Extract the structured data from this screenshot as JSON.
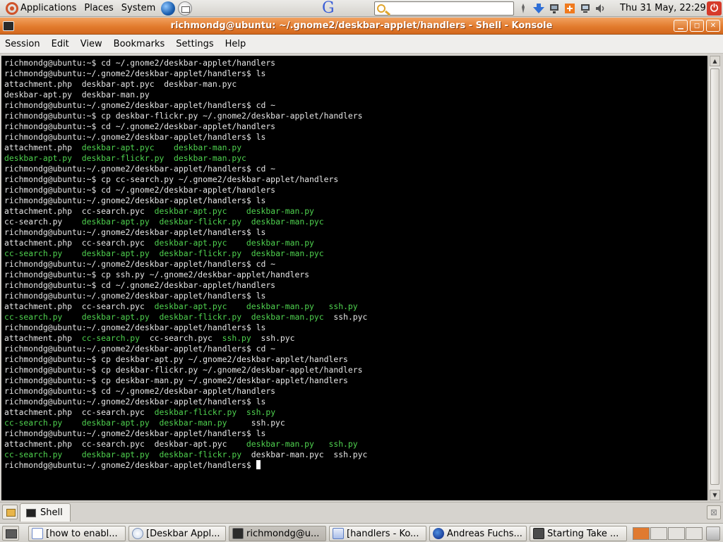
{
  "top_panel": {
    "menus": [
      "Applications",
      "Places",
      "System"
    ],
    "search_placeholder": "",
    "clock": "Thu 31 May, 22:29"
  },
  "window": {
    "title": "richmondg@ubuntu: ~/.gnome2/deskbar-applet/handlers - Shell - Konsole",
    "menu": [
      "Session",
      "Edit",
      "View",
      "Bookmarks",
      "Settings",
      "Help"
    ]
  },
  "terminal": {
    "lines": [
      [
        {
          "t": "richmondg@ubuntu:~$ cd ~/.gnome2/deskbar-applet/handlers"
        }
      ],
      [
        {
          "t": "richmondg@ubuntu:~/.gnome2/deskbar-applet/handlers$ ls"
        }
      ],
      [
        {
          "t": "attachment.php  deskbar-apt.pyc  deskbar-man.pyc"
        }
      ],
      [
        {
          "t": "deskbar-apt.py  deskbar-man.py"
        }
      ],
      [
        {
          "t": "richmondg@ubuntu:~/.gnome2/deskbar-applet/handlers$ cd ~"
        }
      ],
      [
        {
          "t": "richmondg@ubuntu:~$ cp deskbar-flickr.py ~/.gnome2/deskbar-applet/handlers"
        }
      ],
      [
        {
          "t": "richmondg@ubuntu:~$ cd ~/.gnome2/deskbar-applet/handlers"
        }
      ],
      [
        {
          "t": "richmondg@ubuntu:~/.gnome2/deskbar-applet/handlers$ ls"
        }
      ],
      [
        {
          "t": "attachment.php  "
        },
        {
          "t": "deskbar-apt.pyc",
          "g": true
        },
        {
          "t": "    "
        },
        {
          "t": "deskbar-man.py",
          "g": true
        }
      ],
      [
        {
          "t": "deskbar-apt.py",
          "g": true
        },
        {
          "t": "  "
        },
        {
          "t": "deskbar-flickr.py",
          "g": true
        },
        {
          "t": "  "
        },
        {
          "t": "deskbar-man.pyc",
          "g": true
        }
      ],
      [
        {
          "t": "richmondg@ubuntu:~/.gnome2/deskbar-applet/handlers$ cd ~"
        }
      ],
      [
        {
          "t": "richmondg@ubuntu:~$ cp cc-search.py ~/.gnome2/deskbar-applet/handlers"
        }
      ],
      [
        {
          "t": "richmondg@ubuntu:~$ cd ~/.gnome2/deskbar-applet/handlers"
        }
      ],
      [
        {
          "t": "richmondg@ubuntu:~/.gnome2/deskbar-applet/handlers$ ls"
        }
      ],
      [
        {
          "t": "attachment.php  cc-search.pyc  "
        },
        {
          "t": "deskbar-apt.pyc",
          "g": true
        },
        {
          "t": "    "
        },
        {
          "t": "deskbar-man.py",
          "g": true
        }
      ],
      [
        {
          "t": "cc-search.py    "
        },
        {
          "t": "deskbar-apt.py",
          "g": true
        },
        {
          "t": "  "
        },
        {
          "t": "deskbar-flickr.py",
          "g": true
        },
        {
          "t": "  "
        },
        {
          "t": "deskbar-man.pyc",
          "g": true
        }
      ],
      [
        {
          "t": "richmondg@ubuntu:~/.gnome2/deskbar-applet/handlers$ ls"
        }
      ],
      [
        {
          "t": "attachment.php  cc-search.pyc  "
        },
        {
          "t": "deskbar-apt.pyc",
          "g": true
        },
        {
          "t": "    "
        },
        {
          "t": "deskbar-man.py",
          "g": true
        }
      ],
      [
        {
          "t": "cc-search.py",
          "g": true
        },
        {
          "t": "    "
        },
        {
          "t": "deskbar-apt.py",
          "g": true
        },
        {
          "t": "  "
        },
        {
          "t": "deskbar-flickr.py",
          "g": true
        },
        {
          "t": "  "
        },
        {
          "t": "deskbar-man.pyc",
          "g": true
        }
      ],
      [
        {
          "t": "richmondg@ubuntu:~/.gnome2/deskbar-applet/handlers$ cd ~"
        }
      ],
      [
        {
          "t": "richmondg@ubuntu:~$ cp ssh.py ~/.gnome2/deskbar-applet/handlers"
        }
      ],
      [
        {
          "t": "richmondg@ubuntu:~$ cd ~/.gnome2/deskbar-applet/handlers"
        }
      ],
      [
        {
          "t": "richmondg@ubuntu:~/.gnome2/deskbar-applet/handlers$ ls"
        }
      ],
      [
        {
          "t": "attachment.php  cc-search.pyc  "
        },
        {
          "t": "deskbar-apt.pyc",
          "g": true
        },
        {
          "t": "    "
        },
        {
          "t": "deskbar-man.py",
          "g": true
        },
        {
          "t": "   "
        },
        {
          "t": "ssh.py",
          "g": true
        }
      ],
      [
        {
          "t": "cc-search.py",
          "g": true
        },
        {
          "t": "    "
        },
        {
          "t": "deskbar-apt.py",
          "g": true
        },
        {
          "t": "  "
        },
        {
          "t": "deskbar-flickr.py",
          "g": true
        },
        {
          "t": "  "
        },
        {
          "t": "deskbar-man.pyc",
          "g": true
        },
        {
          "t": "  ssh.pyc"
        }
      ],
      [
        {
          "t": "richmondg@ubuntu:~/.gnome2/deskbar-applet/handlers$ ls"
        }
      ],
      [
        {
          "t": "attachment.php  "
        },
        {
          "t": "cc-search.py",
          "g": true
        },
        {
          "t": "  cc-search.pyc  "
        },
        {
          "t": "ssh.py",
          "g": true
        },
        {
          "t": "  ssh.pyc"
        }
      ],
      [
        {
          "t": "richmondg@ubuntu:~/.gnome2/deskbar-applet/handlers$ cd ~"
        }
      ],
      [
        {
          "t": "richmondg@ubuntu:~$ cp deskbar-apt.py ~/.gnome2/deskbar-applet/handlers"
        }
      ],
      [
        {
          "t": "richmondg@ubuntu:~$ cp deskbar-flickr.py ~/.gnome2/deskbar-applet/handlers"
        }
      ],
      [
        {
          "t": "richmondg@ubuntu:~$ cp deskbar-man.py ~/.gnome2/deskbar-applet/handlers"
        }
      ],
      [
        {
          "t": "richmondg@ubuntu:~$ cd ~/.gnome2/deskbar-applet/handlers"
        }
      ],
      [
        {
          "t": "richmondg@ubuntu:~/.gnome2/deskbar-applet/handlers$ ls"
        }
      ],
      [
        {
          "t": "attachment.php  cc-search.pyc  "
        },
        {
          "t": "deskbar-flickr.py",
          "g": true
        },
        {
          "t": "  "
        },
        {
          "t": "ssh.py",
          "g": true
        }
      ],
      [
        {
          "t": "cc-search.py",
          "g": true
        },
        {
          "t": "    "
        },
        {
          "t": "deskbar-apt.py",
          "g": true
        },
        {
          "t": "  "
        },
        {
          "t": "deskbar-man.py",
          "g": true
        },
        {
          "t": "     ssh.pyc"
        }
      ],
      [
        {
          "t": "richmondg@ubuntu:~/.gnome2/deskbar-applet/handlers$ ls"
        }
      ],
      [
        {
          "t": "attachment.php  cc-search.pyc  deskbar-apt.pyc    "
        },
        {
          "t": "deskbar-man.py",
          "g": true
        },
        {
          "t": "   "
        },
        {
          "t": "ssh.py",
          "g": true
        }
      ],
      [
        {
          "t": "cc-search.py",
          "g": true
        },
        {
          "t": "    "
        },
        {
          "t": "deskbar-apt.py",
          "g": true
        },
        {
          "t": "  "
        },
        {
          "t": "deskbar-flickr.py",
          "g": true
        },
        {
          "t": "  deskbar-man.pyc  ssh.pyc"
        }
      ],
      [
        {
          "t": "richmondg@ubuntu:~/.gnome2/deskbar-applet/handlers$ "
        }
      ]
    ]
  },
  "tabbar": {
    "tab_label": "Shell"
  },
  "taskbar": {
    "tasks": [
      {
        "label": "[how to enabl...",
        "icon": "document-icon",
        "active": false
      },
      {
        "label": "[Deskbar Appl...",
        "icon": "deskbar-icon",
        "active": false
      },
      {
        "label": "richmondg@u...",
        "icon": "terminal-icon",
        "active": true
      },
      {
        "label": "[handlers - Ko...",
        "icon": "folder-icon",
        "active": false
      },
      {
        "label": "Andreas Fuchs...",
        "icon": "firefox-icon",
        "active": false
      },
      {
        "label": "Starting Take ...",
        "icon": "camera-icon",
        "active": false
      }
    ],
    "workspace_colors": [
      "#e07a30",
      "#e4e2de",
      "#e4e2de",
      "#e4e2de"
    ]
  },
  "colors": {
    "titlebar": "#e27b2d",
    "terminal_bg": "#000000",
    "terminal_fg": "#e6e6e6",
    "terminal_exec": "#4fd24f"
  }
}
